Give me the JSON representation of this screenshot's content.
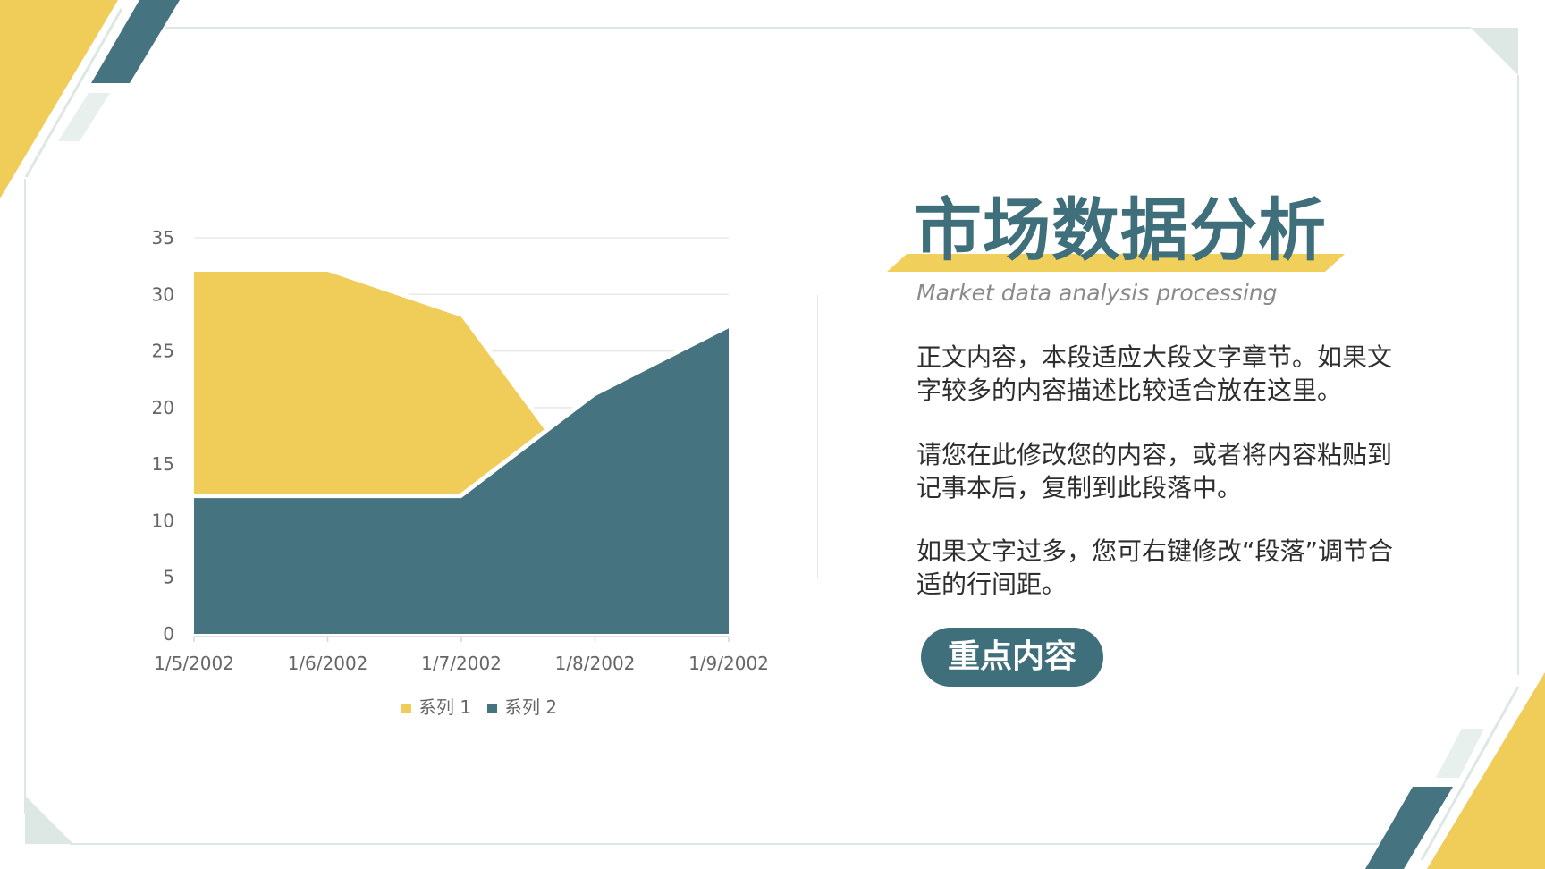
{
  "colors": {
    "teal": "#45737f",
    "yellow": "#f0cd58",
    "mint": "#e3eee9",
    "frame": "#dde7e4",
    "grid": "#e8e8e8",
    "axis_text": "#666666"
  },
  "slide": {
    "title": "市场数据分析",
    "subtitle": "Market data analysis processing",
    "paragraphs": [
      "正文内容，本段适应大段文字章节。如果文字较多的内容描述比较适合放在这里。",
      "请您在此修改您的内容，或者将内容粘贴到记事本后，复制到此段落中。",
      "如果文字过多，您可右键修改“段落”调节合适的行间距。"
    ],
    "button_label": "重点内容"
  },
  "chart_data": {
    "type": "area",
    "categories": [
      "1/5/2002",
      "1/6/2002",
      "1/7/2002",
      "1/8/2002",
      "1/9/2002"
    ],
    "series": [
      {
        "name": "系列 1",
        "values": [
          32,
          32,
          28,
          12,
          12
        ],
        "color": "#f0cd58"
      },
      {
        "name": "系列 2",
        "values": [
          12,
          12,
          12,
          21,
          27
        ],
        "color": "#45737f"
      }
    ],
    "ylim": [
      0,
      35
    ],
    "yticks": [
      0,
      5,
      10,
      15,
      20,
      25,
      30,
      35
    ],
    "grid": true,
    "legend_position": "bottom"
  }
}
